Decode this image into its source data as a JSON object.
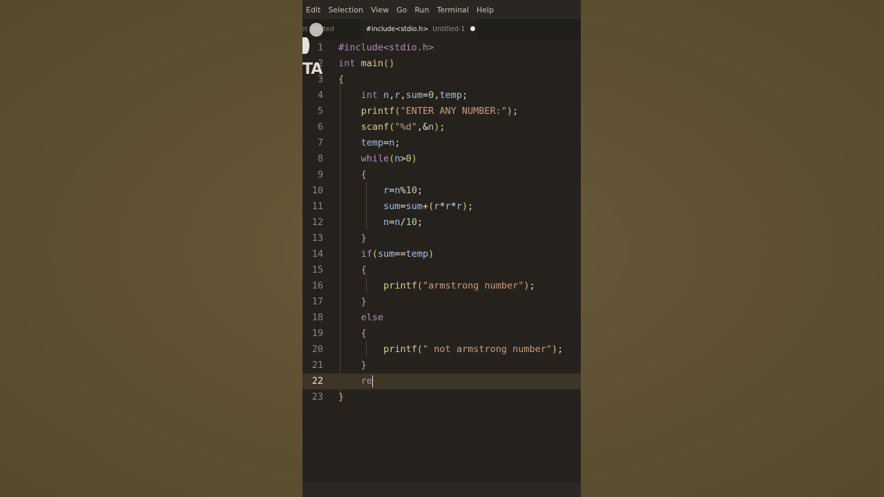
{
  "menu": [
    "Edit",
    "Selection",
    "View",
    "Go",
    "Run",
    "Terminal",
    "Help"
  ],
  "tabs": {
    "get_started": "et Started",
    "active_file": "#include<stdio.h>",
    "active_name": "Untitled-1"
  },
  "overlay_text": "TA",
  "current_line": 22,
  "lines": [
    {
      "n": "1",
      "code": "#include<stdio.h>"
    },
    {
      "n": "2",
      "code": "int main()"
    },
    {
      "n": "3",
      "code": "{"
    },
    {
      "n": "4",
      "code": "    int n,r,sum=0,temp;"
    },
    {
      "n": "5",
      "code": "    printf(\"ENTER ANY NUMBER:\");"
    },
    {
      "n": "6",
      "code": "    scanf(\"%d\",&n);"
    },
    {
      "n": "7",
      "code": "    temp=n;"
    },
    {
      "n": "8",
      "code": "    while(n>0)"
    },
    {
      "n": "9",
      "code": "    {"
    },
    {
      "n": "10",
      "code": "        r=n%10;"
    },
    {
      "n": "11",
      "code": "        sum=sum+(r*r*r);"
    },
    {
      "n": "12",
      "code": "        n=n/10;"
    },
    {
      "n": "13",
      "code": "    }"
    },
    {
      "n": "14",
      "code": "    if(sum==temp)"
    },
    {
      "n": "15",
      "code": "    {"
    },
    {
      "n": "16",
      "code": "        printf(\"armstrong number\");"
    },
    {
      "n": "17",
      "code": "    }"
    },
    {
      "n": "18",
      "code": "    else"
    },
    {
      "n": "19",
      "code": "    {"
    },
    {
      "n": "20",
      "code": "        printf(\" not armstrong number\");"
    },
    {
      "n": "21",
      "code": "    }"
    },
    {
      "n": "22",
      "code": "    re"
    },
    {
      "n": "23",
      "code": "}"
    }
  ],
  "colors": {
    "background": "#5e5031",
    "editor_bg": "#25221e",
    "current_line_bg": "#3d3526",
    "keyword": "#9b8fb8",
    "function": "#dccf8a",
    "string": "#cf9a75",
    "number": "#b9d3a4",
    "variable": "#9fc3e6",
    "control": "#c086c0"
  }
}
